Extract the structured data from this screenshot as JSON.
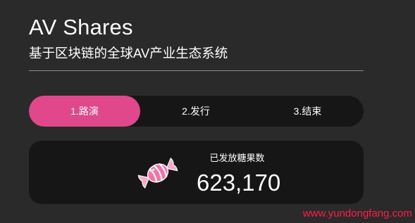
{
  "header": {
    "title": "AV Shares",
    "subtitle": "基于区块链的全球AV产业生态系统"
  },
  "steps": [
    {
      "label": "1.路演",
      "active": true
    },
    {
      "label": "2.发行",
      "active": false
    },
    {
      "label": "3.结束",
      "active": false
    }
  ],
  "stats": {
    "label": "已发放糖果数",
    "value": "623,170",
    "icon": "candy-icon"
  },
  "watermark": "www.yundongfang.com",
  "colors": {
    "background": "#2a2a2a",
    "panel": "#161616",
    "accent": "#e0488b",
    "watermark": "#ff1c4a"
  }
}
